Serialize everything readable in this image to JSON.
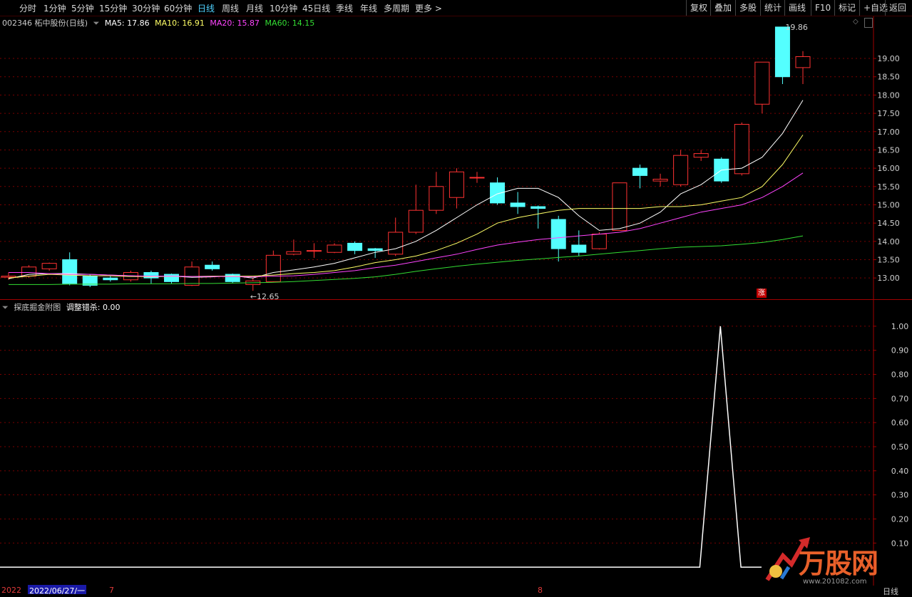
{
  "toolbar": {
    "tabs": [
      "分时",
      "1分钟",
      "5分钟",
      "15分钟",
      "30分钟",
      "60分钟",
      "日线",
      "周线",
      "月线",
      "10分钟",
      "45日线",
      "季线",
      "年线",
      "多周期",
      "更多 >"
    ],
    "active": "日线",
    "right_buttons": [
      "复权",
      "叠加",
      "多股",
      "统计",
      "画线",
      "F10",
      "标记",
      "+自选",
      "返回"
    ]
  },
  "main_header": {
    "stock": "002346 柘中股份(日线)",
    "ma5": "MA5: 17.86",
    "ma10": "MA10: 16.91",
    "ma20": "MA20: 15.87",
    "ma60": "MA60: 14.15"
  },
  "sub_header": {
    "name": "探底掘金附图",
    "label": "调整错杀: 0.00"
  },
  "labels": {
    "high": "19.86",
    "low": "←12.65",
    "zhang": "涨",
    "date_start": "2022",
    "date_sel": "2022/06/27/一",
    "month7": "7",
    "month8": "8",
    "period": "日线"
  },
  "logo": {
    "text": "万股网",
    "url": "www.201082.com"
  },
  "colors": {
    "up": "#ff3232",
    "down": "#54ffff",
    "ma5": "#ffffff",
    "ma10": "#ffff66",
    "ma20": "#ff44ff",
    "ma60": "#33dd33",
    "grid": "#7a0000"
  },
  "chart_data": [
    {
      "type": "candlestick",
      "title": "002346 柘中股份(日线)",
      "y_ticks": [
        13.0,
        13.5,
        14.0,
        14.5,
        15.0,
        15.5,
        16.0,
        16.5,
        17.0,
        17.5,
        18.0,
        18.5,
        19.0
      ],
      "ylim": [
        12.4,
        20.15
      ],
      "candles": [
        {
          "o": 13.02,
          "c": 13.05,
          "h": 13.15,
          "l": 12.95
        },
        {
          "o": 13.05,
          "c": 13.3,
          "h": 13.35,
          "l": 13.0
        },
        {
          "o": 13.25,
          "c": 13.4,
          "h": 13.42,
          "l": 13.2
        },
        {
          "o": 13.5,
          "c": 12.85,
          "h": 13.7,
          "l": 12.8
        },
        {
          "o": 13.05,
          "c": 12.8,
          "h": 13.1,
          "l": 12.75
        },
        {
          "o": 13.0,
          "c": 12.95,
          "h": 13.05,
          "l": 12.9
        },
        {
          "o": 12.95,
          "c": 13.15,
          "h": 13.2,
          "l": 12.9
        },
        {
          "o": 13.15,
          "c": 13.0,
          "h": 13.2,
          "l": 12.85
        },
        {
          "o": 13.1,
          "c": 12.9,
          "h": 13.12,
          "l": 12.85
        },
        {
          "o": 12.8,
          "c": 13.3,
          "h": 13.45,
          "l": 12.78
        },
        {
          "o": 13.35,
          "c": 13.25,
          "h": 13.45,
          "l": 13.2
        },
        {
          "o": 13.1,
          "c": 12.9,
          "h": 13.12,
          "l": 12.85
        },
        {
          "o": 12.82,
          "c": 12.92,
          "h": 13.0,
          "l": 12.65
        },
        {
          "o": 12.9,
          "c": 13.62,
          "h": 13.75,
          "l": 12.88
        },
        {
          "o": 13.65,
          "c": 13.72,
          "h": 14.05,
          "l": 13.62
        },
        {
          "o": 13.75,
          "c": 13.75,
          "h": 13.95,
          "l": 13.55
        },
        {
          "o": 13.7,
          "c": 13.9,
          "h": 13.95,
          "l": 13.68
        },
        {
          "o": 13.95,
          "c": 13.75,
          "h": 14.0,
          "l": 13.65
        },
        {
          "o": 13.8,
          "c": 13.75,
          "h": 13.82,
          "l": 13.55
        },
        {
          "o": 13.65,
          "c": 14.25,
          "h": 14.65,
          "l": 13.6
        },
        {
          "o": 14.25,
          "c": 14.85,
          "h": 15.55,
          "l": 14.2
        },
        {
          "o": 14.85,
          "c": 15.5,
          "h": 15.9,
          "l": 14.75
        },
        {
          "o": 15.2,
          "c": 15.9,
          "h": 16.0,
          "l": 14.9
        },
        {
          "o": 15.75,
          "c": 15.75,
          "h": 15.9,
          "l": 15.6
        },
        {
          "o": 15.6,
          "c": 15.05,
          "h": 15.75,
          "l": 15.0
        },
        {
          "o": 15.05,
          "c": 14.95,
          "h": 15.35,
          "l": 14.75
        },
        {
          "o": 14.95,
          "c": 14.9,
          "h": 14.98,
          "l": 14.35
        },
        {
          "o": 14.6,
          "c": 13.8,
          "h": 14.7,
          "l": 13.45
        },
        {
          "o": 13.9,
          "c": 13.7,
          "h": 14.3,
          "l": 13.6
        },
        {
          "o": 13.8,
          "c": 14.2,
          "h": 14.25,
          "l": 13.78
        },
        {
          "o": 14.3,
          "c": 15.6,
          "h": 15.6,
          "l": 14.3
        },
        {
          "o": 16.0,
          "c": 15.8,
          "h": 16.1,
          "l": 15.45
        },
        {
          "o": 15.65,
          "c": 15.7,
          "h": 15.85,
          "l": 15.5
        },
        {
          "o": 15.55,
          "c": 16.35,
          "h": 16.5,
          "l": 15.5
        },
        {
          "o": 16.3,
          "c": 16.4,
          "h": 16.5,
          "l": 16.2
        },
        {
          "o": 16.25,
          "c": 15.65,
          "h": 16.3,
          "l": 15.6
        },
        {
          "o": 15.85,
          "c": 17.2,
          "h": 17.25,
          "l": 15.8
        },
        {
          "o": 17.75,
          "c": 18.9,
          "h": 18.9,
          "l": 17.5
        },
        {
          "o": 19.86,
          "c": 18.5,
          "h": 19.86,
          "l": 18.3
        },
        {
          "o": 18.75,
          "c": 19.05,
          "h": 19.2,
          "l": 18.3
        }
      ],
      "series": [
        {
          "name": "MA5",
          "values": [
            12.98,
            13.1,
            13.12,
            13.12,
            13.1,
            13.08,
            13.06,
            13.03,
            13.05,
            13.02,
            13.03,
            13.06,
            13.0,
            13.15,
            13.22,
            13.3,
            13.4,
            13.55,
            13.7,
            13.8,
            14.0,
            14.3,
            14.65,
            15.0,
            15.3,
            15.45,
            15.45,
            15.2,
            14.7,
            14.3,
            14.35,
            14.5,
            14.8,
            15.3,
            15.55,
            15.95,
            16.0,
            16.3,
            16.95,
            17.86
          ]
        },
        {
          "name": "MA10",
          "values": [
            13.0,
            13.05,
            13.1,
            13.08,
            13.06,
            13.06,
            13.04,
            13.04,
            13.05,
            13.04,
            13.05,
            13.05,
            13.05,
            13.08,
            13.12,
            13.15,
            13.2,
            13.3,
            13.42,
            13.5,
            13.6,
            13.75,
            13.95,
            14.2,
            14.5,
            14.65,
            14.75,
            14.85,
            14.9,
            14.9,
            14.9,
            14.9,
            14.95,
            14.95,
            15.0,
            15.1,
            15.2,
            15.5,
            16.1,
            16.91
          ]
        },
        {
          "name": "MA20",
          "values": [
            13.15,
            13.15,
            13.12,
            13.1,
            13.1,
            13.08,
            13.06,
            13.05,
            13.05,
            13.04,
            13.04,
            13.04,
            13.03,
            13.05,
            13.06,
            13.1,
            13.15,
            13.2,
            13.28,
            13.35,
            13.45,
            13.55,
            13.65,
            13.78,
            13.9,
            13.98,
            14.05,
            14.1,
            14.15,
            14.2,
            14.25,
            14.35,
            14.5,
            14.65,
            14.8,
            14.9,
            15.0,
            15.2,
            15.5,
            15.87
          ]
        },
        {
          "name": "MA60",
          "values": [
            12.82,
            12.82,
            12.82,
            12.83,
            12.83,
            12.83,
            12.84,
            12.84,
            12.84,
            12.85,
            12.85,
            12.86,
            12.87,
            12.88,
            12.9,
            12.93,
            12.96,
            12.99,
            13.03,
            13.1,
            13.18,
            13.25,
            13.32,
            13.38,
            13.43,
            13.48,
            13.52,
            13.56,
            13.6,
            13.65,
            13.7,
            13.75,
            13.8,
            13.84,
            13.86,
            13.88,
            13.92,
            13.97,
            14.05,
            14.15
          ]
        }
      ]
    },
    {
      "type": "line",
      "title": "探底掘金附图",
      "y_ticks": [
        0.1,
        0.2,
        0.3,
        0.4,
        0.5,
        0.6,
        0.7,
        0.8,
        0.9,
        1.0
      ],
      "ylim": [
        -0.05,
        1.05
      ],
      "series": [
        {
          "name": "调整错杀",
          "values": [
            0,
            0,
            0,
            0,
            0,
            0,
            0,
            0,
            0,
            0,
            0,
            0,
            0,
            0,
            0,
            0,
            0,
            0,
            0,
            0,
            0,
            0,
            0,
            0,
            0,
            0,
            0,
            0,
            0,
            0,
            0,
            0,
            0,
            0,
            0,
            1,
            0,
            0
          ]
        }
      ]
    }
  ]
}
